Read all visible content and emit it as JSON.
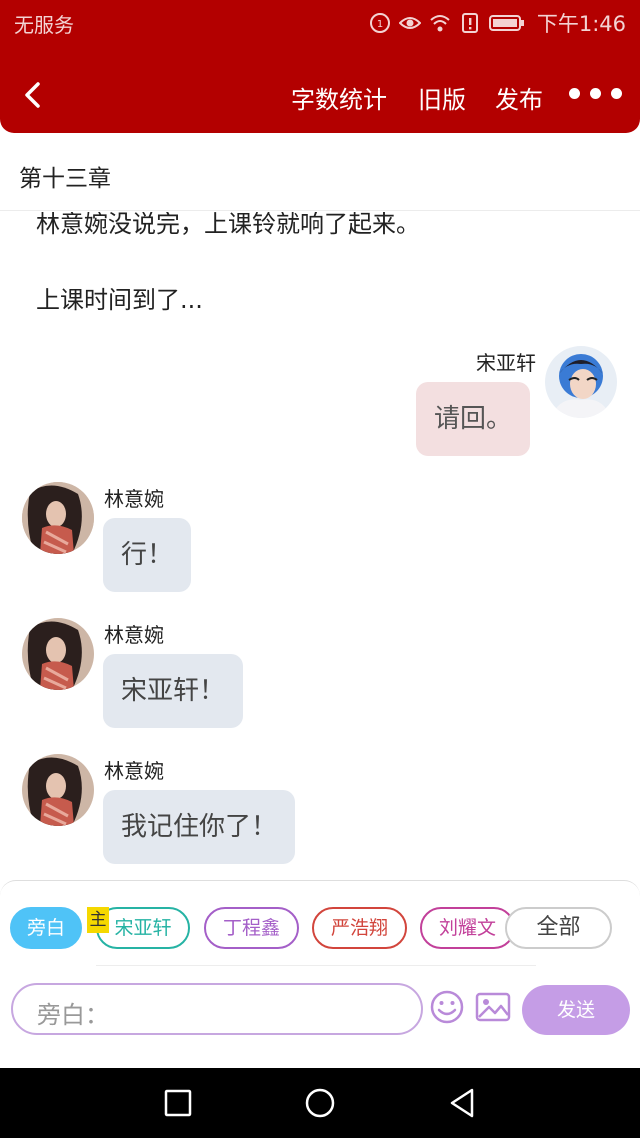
{
  "status_bar": {
    "carrier": "无服务",
    "time": "下午1:46"
  },
  "app_bar": {
    "word_count": "字数统计",
    "old_version": "旧版",
    "publish": "发布"
  },
  "chapter": {
    "title": "第十三章"
  },
  "content": {
    "paragraphs": [
      "林意婉没说完，上课铃就响了起来。",
      "上课时间到了..."
    ],
    "messages": [
      {
        "speaker": "宋亚轩",
        "text": "请回。",
        "side": "right"
      },
      {
        "speaker": "林意婉",
        "text": "行！",
        "side": "left"
      },
      {
        "speaker": "林意婉",
        "text": "宋亚轩！",
        "side": "left"
      },
      {
        "speaker": "林意婉",
        "text": "我记住你了！",
        "side": "left"
      }
    ]
  },
  "composer": {
    "role_tag": "主",
    "chips": [
      {
        "label": "旁白",
        "color": "#4fc3f7",
        "active": true
      },
      {
        "label": "宋亚轩",
        "color": "#26b3a4",
        "active": false
      },
      {
        "label": "丁程鑫",
        "color": "#a45fc8",
        "active": false
      },
      {
        "label": "严浩翔",
        "color": "#d2453c",
        "active": false
      },
      {
        "label": "刘耀文",
        "color": "#c2409a",
        "active": false
      },
      {
        "label": "全部",
        "color": "#bbbbbb",
        "active": false
      }
    ],
    "input_placeholder": "旁白：",
    "send_label": "发送"
  },
  "colors": {
    "brand": "#b30000",
    "send": "#c59de6"
  }
}
